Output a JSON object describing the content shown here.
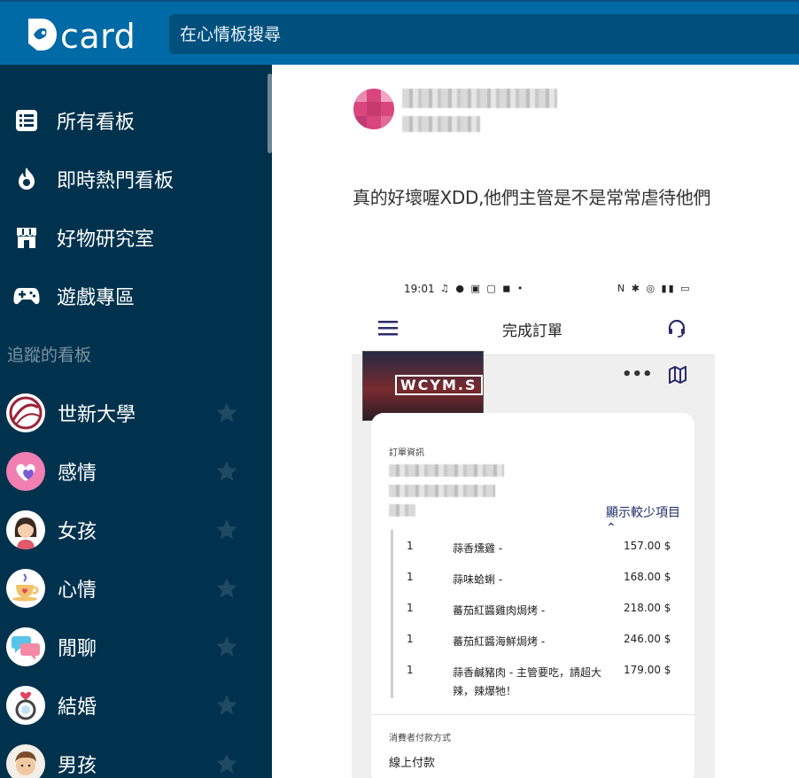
{
  "app": {
    "logo_text": "card",
    "search_placeholder": "在心情板搜尋"
  },
  "sidebar": {
    "nav": [
      {
        "label": "所有看板",
        "icon": "list-icon"
      },
      {
        "label": "即時熱門看板",
        "icon": "flame-icon"
      },
      {
        "label": "好物研究室",
        "icon": "store-icon"
      },
      {
        "label": "遊戲專區",
        "icon": "gamepad-icon"
      }
    ],
    "followed_title": "追蹤的看板",
    "boards": [
      {
        "label": "世新大學",
        "avatar": "school-logo-icon"
      },
      {
        "label": "感情",
        "avatar": "heart-icon"
      },
      {
        "label": "女孩",
        "avatar": "girl-icon"
      },
      {
        "label": "心情",
        "avatar": "coffee-cup-icon"
      },
      {
        "label": "閒聊",
        "avatar": "chat-bubbles-icon"
      },
      {
        "label": "結婚",
        "avatar": "ring-icon"
      },
      {
        "label": "男孩",
        "avatar": "boy-icon"
      }
    ]
  },
  "post": {
    "comment_text": "真的好壞喔XDD,他們主管是不是常常虐待他們",
    "screenshot": {
      "status_time": "19:01",
      "page_title": "完成訂單",
      "thumb_text": "WCYM.S",
      "order_info_label": "訂單資訊",
      "toggle_label": "顯示較少項目",
      "items": [
        {
          "qty": "1",
          "name": "蒜香燻雞 -",
          "price": "157.00 $"
        },
        {
          "qty": "1",
          "name": "蒜味蛤蜊 -",
          "price": "168.00 $"
        },
        {
          "qty": "1",
          "name": "蕃茄紅醬雞肉焗烤 -",
          "price": "218.00 $"
        },
        {
          "qty": "1",
          "name": "蕃茄紅醬海鮮焗烤 -",
          "price": "246.00 $"
        },
        {
          "qty": "1",
          "name": "蒜香鹹豬肉 - 主管要吃，請超大辣，辣爆牠！",
          "price": "179.00 $"
        }
      ],
      "payment_label": "消費者付款方式",
      "payment_value": "線上付款"
    }
  },
  "colors": {
    "topbar": "#006aa6",
    "sidebar": "#00324e",
    "search": "#00507e"
  }
}
